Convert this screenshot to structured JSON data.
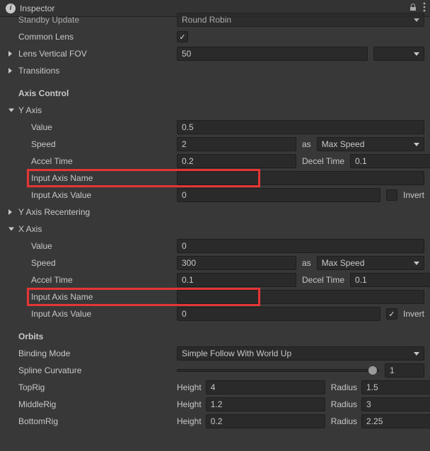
{
  "titlebar": {
    "title": "Inspector"
  },
  "top": {
    "standby_update_label": "Standby Update",
    "standby_update_value": "Round Robin",
    "common_lens_label": "Common Lens",
    "common_lens_checked": true,
    "lens_fov_label": "Lens Vertical FOV",
    "lens_fov_value": "50",
    "transitions_label": "Transitions"
  },
  "axis_control_header": "Axis Control",
  "yaxis": {
    "header": "Y Axis",
    "value_label": "Value",
    "value": "0.5",
    "speed_label": "Speed",
    "speed": "2",
    "as_label": "as",
    "speed_mode": "Max Speed",
    "accel_label": "Accel Time",
    "accel": "0.2",
    "decel_label": "Decel Time",
    "decel": "0.1",
    "axis_name_label": "Input Axis Name",
    "axis_name": "",
    "axis_value_label": "Input Axis Value",
    "axis_value": "0",
    "invert_label": "Invert",
    "invert_checked": false,
    "recentering_label": "Y Axis Recentering"
  },
  "xaxis": {
    "header": "X Axis",
    "value_label": "Value",
    "value": "0",
    "speed_label": "Speed",
    "speed": "300",
    "as_label": "as",
    "speed_mode": "Max Speed",
    "accel_label": "Accel Time",
    "accel": "0.1",
    "decel_label": "Decel Time",
    "decel": "0.1",
    "axis_name_label": "Input Axis Name",
    "axis_name": "",
    "axis_value_label": "Input Axis Value",
    "axis_value": "0",
    "invert_label": "Invert",
    "invert_checked": true
  },
  "orbits": {
    "header": "Orbits",
    "binding_label": "Binding Mode",
    "binding_value": "Simple Follow With World Up",
    "spline_label": "Spline Curvature",
    "spline_value": "1",
    "slider_pos_pct": 97,
    "height_label": "Height",
    "radius_label": "Radius",
    "rigs": [
      {
        "name": "TopRig",
        "height": "4",
        "radius": "1.5"
      },
      {
        "name": "MiddleRig",
        "height": "1.2",
        "radius": "3"
      },
      {
        "name": "BottomRig",
        "height": "0.2",
        "radius": "2.25"
      }
    ]
  }
}
